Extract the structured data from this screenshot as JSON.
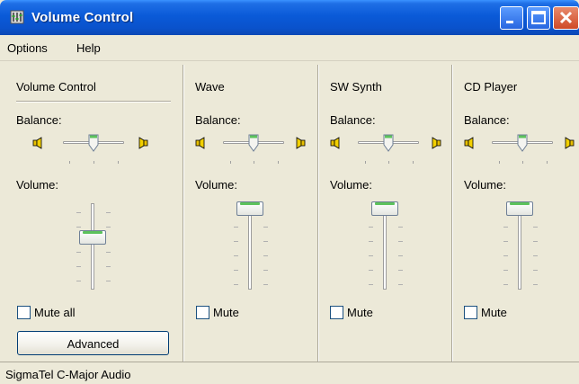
{
  "window": {
    "title": "Volume Control"
  },
  "menu": {
    "items": [
      "Options",
      "Help"
    ]
  },
  "columns": [
    {
      "title": "Volume Control",
      "balance_label": "Balance:",
      "volume_label": "Volume:",
      "mute_label": "Mute all",
      "volume_level": 0.5,
      "balance": 0.0
    },
    {
      "title": "Wave",
      "balance_label": "Balance:",
      "volume_label": "Volume:",
      "mute_label": "Mute",
      "volume_level": 1.0,
      "balance": 0.0
    },
    {
      "title": "SW Synth",
      "balance_label": "Balance:",
      "volume_label": "Volume:",
      "mute_label": "Mute",
      "volume_level": 1.0,
      "balance": 0.0
    },
    {
      "title": "CD Player",
      "balance_label": "Balance:",
      "volume_label": "Volume:",
      "mute_label": "Mute",
      "volume_level": 1.0,
      "balance": 0.0
    }
  ],
  "advanced_button": {
    "label": "Advanced"
  },
  "status": {
    "text": "SigmaTel C-Major Audio"
  },
  "colors": {
    "titlebar": "#0a5ad8",
    "thumb_accent": "#5cc25c",
    "background": "#ece9d8"
  },
  "icons": {
    "app": "volume-control-icon",
    "speaker_left": "speaker-left-icon",
    "speaker_right": "speaker-right-icon"
  }
}
